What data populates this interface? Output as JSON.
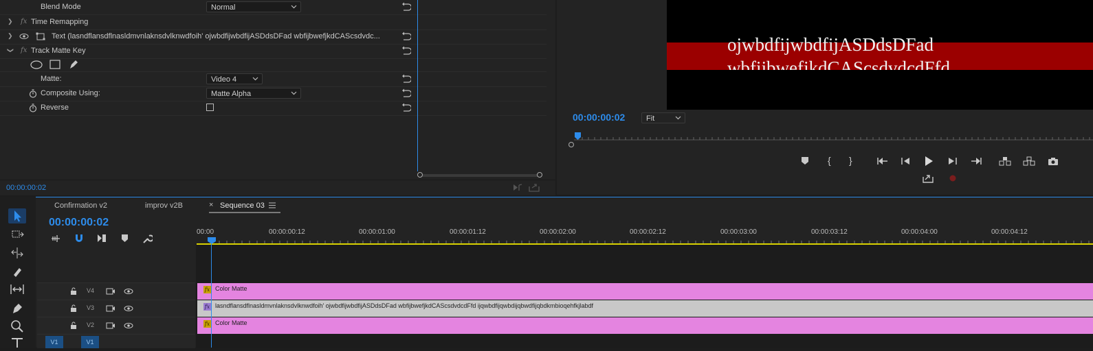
{
  "effect_controls": {
    "blend_mode": {
      "label": "Blend Mode",
      "value": "Normal"
    },
    "time_remapping": {
      "label": "Time Remapping"
    },
    "text_layer": {
      "label": "Text (lasndflansdflnasldmvnlaknsdvlknwdfoih' ojwbdfijwbdfijASDdsDFad wbfijbwefjkdCAScsdvdc..."
    },
    "track_matte_key": {
      "label": "Track Matte Key",
      "matte": {
        "label": "Matte:",
        "value": "Video 4"
      },
      "composite_using": {
        "label": "Composite Using:",
        "value": "Matte Alpha"
      },
      "reverse": {
        "label": "Reverse",
        "checked": false
      }
    },
    "timecode": "00:00:00:02"
  },
  "program_monitor": {
    "video_line_1": "ojwbdfijwbdfijASDdsDFad",
    "video_line_2": "wbfijbwefjkdCAScsdvdcdFfd",
    "timecode": "00:00:00:02",
    "zoom": "Fit",
    "bar_color": "#9b0000"
  },
  "timeline": {
    "tabs": [
      "Confirmation v2",
      "improv v2B",
      "Sequence 03"
    ],
    "active_tab": "Sequence 03",
    "timecode": "00:00:00:02",
    "ruler": [
      "00:00",
      "00:00:00:12",
      "00:00:01:00",
      "00:00:01:12",
      "00:00:02:00",
      "00:00:02:12",
      "00:00:03:00",
      "00:00:03:12",
      "00:00:04:00",
      "00:00:04:12"
    ],
    "tracks": [
      {
        "name": "V4",
        "clip": "Color Matte",
        "clip_color": "#e484e0"
      },
      {
        "name": "V3",
        "clip": "lasndflansdflnasldmvnlaknsdvlknwdfoih' ojwbdfijwbdfijASDdsDFad    wbfijbwefjkdCAScsdvdcdFfd ijqwbdfijqwbdijqbwdfijqbdkmbioqehfkjlabdf",
        "clip_color": "#c8c8c8"
      },
      {
        "name": "V2",
        "clip": "Color Matte",
        "clip_color": "#e484e0"
      },
      {
        "name": "V1",
        "clip": "",
        "clip_color": ""
      }
    ],
    "v1_labels": [
      "V1",
      "V1"
    ]
  }
}
